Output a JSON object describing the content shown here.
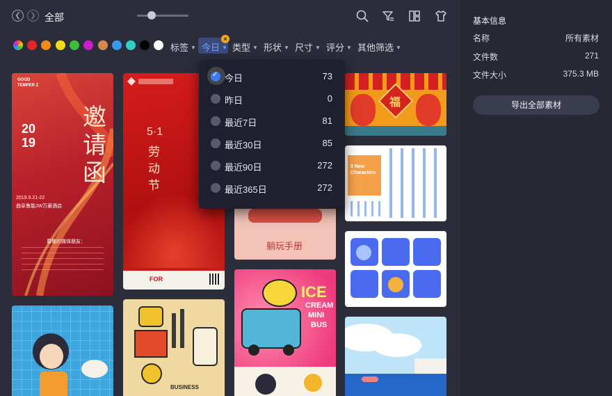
{
  "header": {
    "title": "全部"
  },
  "filters": {
    "colors": [
      "rainbow",
      "#e0252c",
      "#f08c1a",
      "#f3d91a",
      "#3bbf3b",
      "#c61ec9",
      "#d68a4a",
      "#3a97ee",
      "#2ed0c4",
      "#000000",
      "#ffffff"
    ],
    "tags_label": "标签",
    "today_label": "今日",
    "type_label": "类型",
    "shape_label": "形状",
    "size_label": "尺寸",
    "rating_label": "评分",
    "other_label": "其他筛选",
    "clear_icon": "×"
  },
  "dropdown": {
    "items": [
      {
        "label": "今日",
        "count": "73",
        "selected": true
      },
      {
        "label": "昨日",
        "count": "0",
        "selected": false
      },
      {
        "label": "最近7日",
        "count": "81",
        "selected": false
      },
      {
        "label": "最近30日",
        "count": "85",
        "selected": false
      },
      {
        "label": "最近90日",
        "count": "272",
        "selected": false
      },
      {
        "label": "最近365日",
        "count": "272",
        "selected": false
      }
    ]
  },
  "cards": {
    "c1_brand": "GOOD\nTEMPER Z",
    "c1_big": "邀请函",
    "c1_year": "2019",
    "c1_date": "2019.9.21-22",
    "c1_place": "曲阜鲁能JW万豪酒店",
    "c1_greet": "尊敬的媒体朋友：",
    "c2_title": "5·1",
    "c2_sub": "劳动节",
    "c2_brand": "FOR",
    "c4_text": "躺玩手册",
    "c5_title": "ICE",
    "c5_sub1": "CREAM",
    "c5_sub2": "MINI",
    "c5_sub3": "BUS",
    "c6_char": "福",
    "c7_text": "5 New\nCharacters",
    "c9_text": "BUSINESS"
  },
  "side": {
    "title": "基本信息",
    "rows": [
      {
        "key": "名称",
        "value": "所有素材"
      },
      {
        "key": "文件数",
        "value": "271"
      },
      {
        "key": "文件大小",
        "value": "375.3 MB"
      }
    ],
    "export_label": "导出全部素材"
  }
}
